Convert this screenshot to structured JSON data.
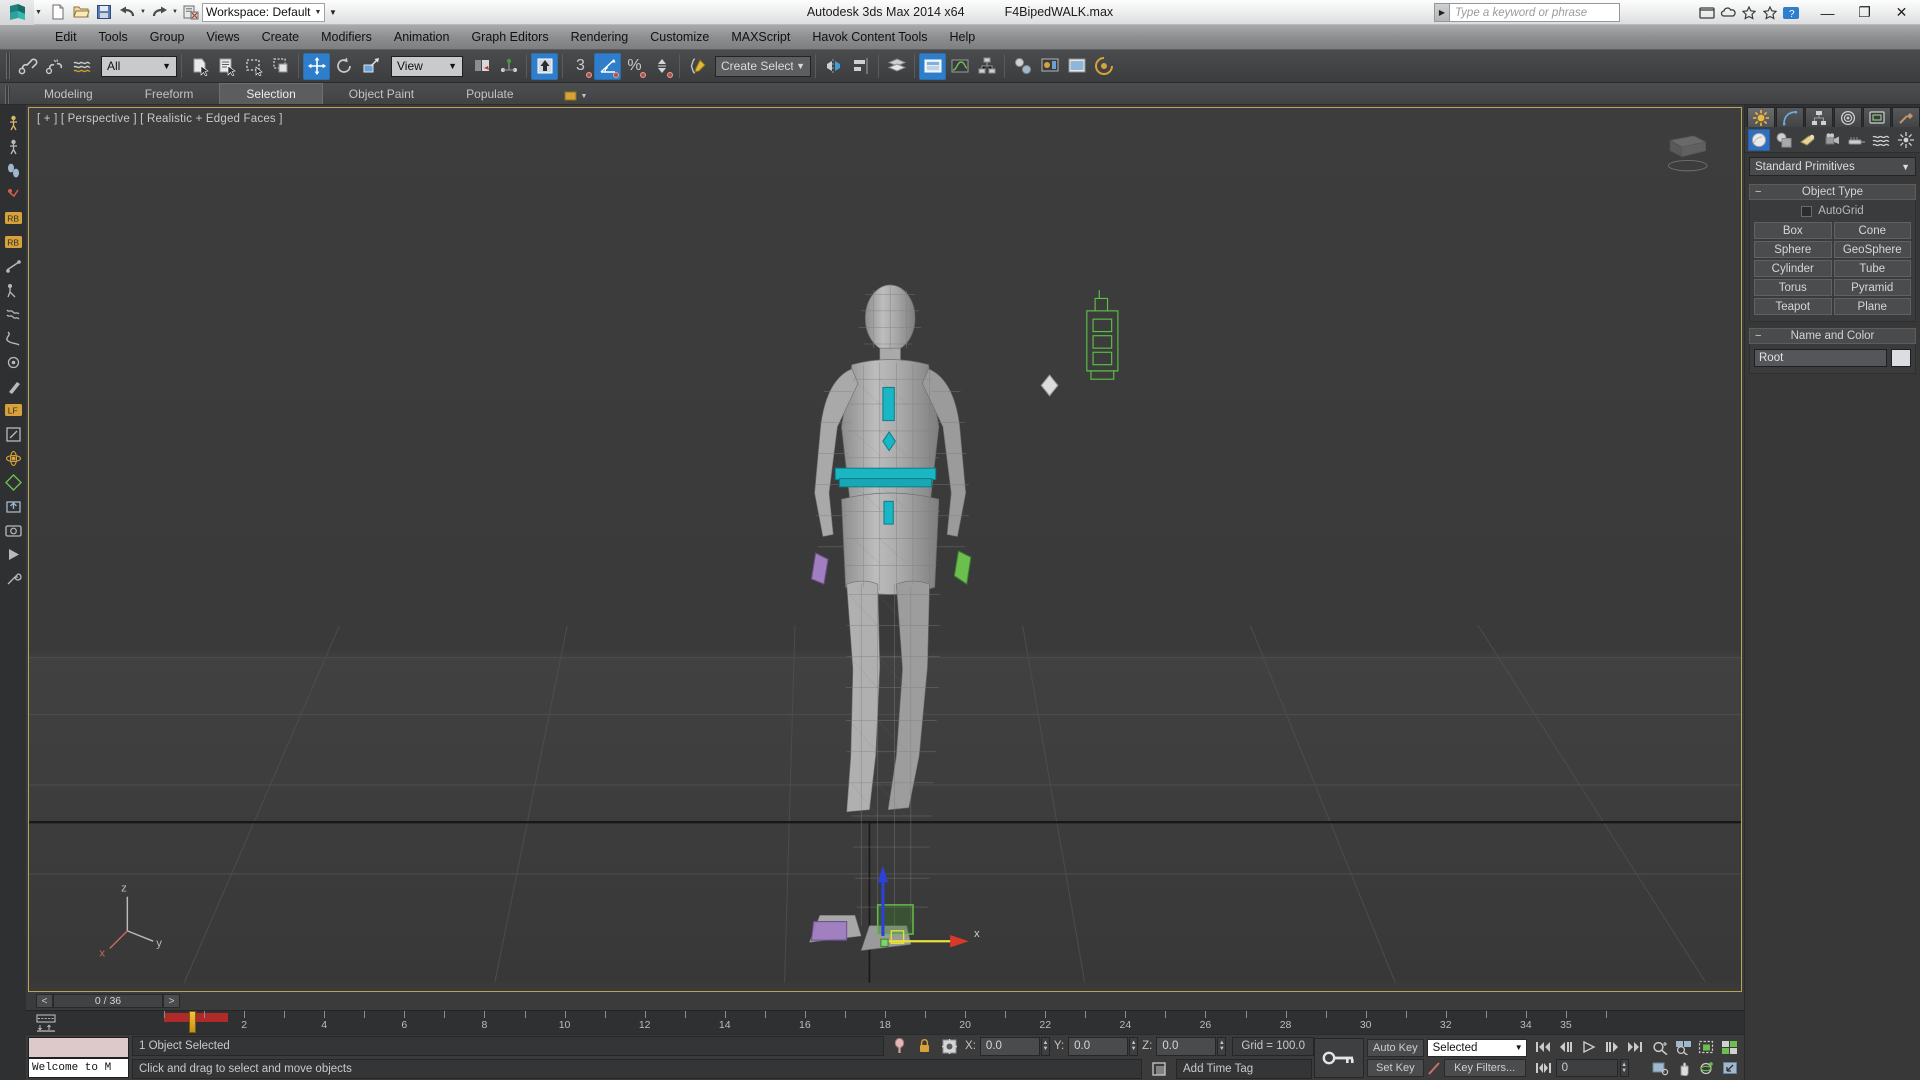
{
  "titlebar": {
    "app_title": "Autodesk 3ds Max  2014 x64",
    "file_name": "F4BipedWALK.max",
    "workspace_label": "Workspace: Default",
    "quick_access": [
      "new-icon",
      "open-icon",
      "save-icon",
      "undo-icon",
      "redo-icon",
      "project-folder-icon"
    ],
    "window_controls": {
      "minimize": "—",
      "restore": "❐",
      "close": "✕"
    }
  },
  "menu": {
    "items": [
      "Edit",
      "Tools",
      "Group",
      "Views",
      "Create",
      "Modifiers",
      "Animation",
      "Graph Editors",
      "Rendering",
      "Customize",
      "MAXScript",
      "Havok Content Tools",
      "Help"
    ]
  },
  "search": {
    "placeholder": "Type a keyword or phrase"
  },
  "toolbar": {
    "selection_filter": "All",
    "ref_coord_system": "View",
    "named_selection_set": "Create Selection Se",
    "angle_snap_value": "3",
    "buttons": [
      "select-link-icon",
      "unlink-icon",
      "bind-space-warp-icon",
      "select-object-icon",
      "select-by-name-icon",
      "rectangular-select-icon",
      "window-crossing-icon",
      "select-and-move-icon",
      "select-and-rotate-icon",
      "select-and-scale-icon",
      "use-pivot-center-icon",
      "select-and-manipulate-icon",
      "snap-toggle-icon",
      "angle-snap-icon",
      "percent-snap-icon",
      "spinner-snap-icon",
      "edit-named-selection-icon",
      "mirror-icon",
      "align-icon",
      "layer-manager-icon",
      "graphite-toggle-icon",
      "curve-editor-icon",
      "schematic-view-icon",
      "material-editor-icon",
      "render-setup-icon",
      "render-frame-icon",
      "render-production-icon"
    ]
  },
  "ribbon": {
    "tabs": [
      "Modeling",
      "Freeform",
      "Selection",
      "Object Paint",
      "Populate"
    ],
    "active_tab": "Selection"
  },
  "viewport": {
    "label": "[ + ] [ Perspective ] [ Realistic + Edged Faces ]",
    "grid_axis_x_label": "x",
    "axis_tripod": {
      "z": "z",
      "x": "x",
      "y": "y"
    }
  },
  "timeline": {
    "frame_display": "0 / 36",
    "prev_label": "<",
    "next_label": ">",
    "tick_labels": [
      "2",
      "4",
      "6",
      "8",
      "10",
      "12",
      "14",
      "16",
      "18",
      "20",
      "22",
      "24",
      "26",
      "28",
      "30",
      "32",
      "34",
      "35"
    ],
    "current_frame": 0,
    "total_frames": 36
  },
  "status": {
    "minilistener_text": "Welcome to M",
    "selection_status": "1 Object Selected",
    "prompt": "Click and drag to select and move objects",
    "coords": {
      "x_label": "X:",
      "x": "0.0",
      "y_label": "Y:",
      "y": "0.0",
      "z_label": "Z:",
      "z": "0.0"
    },
    "grid_text": "Grid = 100.0",
    "add_time_tag": "Add Time Tag"
  },
  "animation": {
    "auto_key": "Auto Key",
    "set_key": "Set Key",
    "key_filters": "Key Filters...",
    "key_mode_selected": "Selected",
    "current_frame_field": "0",
    "playback_icons": [
      "go-to-start-icon",
      "previous-frame-icon",
      "play-animation-icon",
      "next-frame-icon",
      "go-to-end-icon"
    ],
    "nav_icons": [
      "zoom-icon",
      "zoom-all-icon",
      "zoom-extents-icon",
      "zoom-extents-all-icon",
      "field-of-view-icon",
      "pan-view-icon",
      "orbit-icon",
      "maximize-viewport-icon"
    ]
  },
  "command_panel": {
    "tabs": [
      "create-tab-icon",
      "modify-tab-icon",
      "hierarchy-tab-icon",
      "motion-tab-icon",
      "display-tab-icon",
      "utilities-tab-icon"
    ],
    "active_tab_index": 0,
    "category_icons": [
      "geometry-icon",
      "shapes-icon",
      "lights-icon",
      "cameras-icon",
      "helpers-icon",
      "space-warps-icon",
      "systems-icon"
    ],
    "active_category_index": 0,
    "subcategory": "Standard Primitives",
    "object_type": {
      "title": "Object Type",
      "autogrid_label": "AutoGrid",
      "autogrid_checked": false,
      "buttons": [
        "Box",
        "Cone",
        "Sphere",
        "GeoSphere",
        "Cylinder",
        "Tube",
        "Torus",
        "Pyramid",
        "Teapot",
        "Plane"
      ]
    },
    "name_and_color": {
      "title": "Name and Color",
      "name": "Root",
      "color": "#dcdde0"
    }
  },
  "left_rail": {
    "icons": [
      "biped-create-icon",
      "biped-figure-icon",
      "biped-footstep-icon",
      "biped-motion-icon",
      "rb-solver-icon",
      "rb-body-icon",
      "constraint-icon",
      "ragdoll-icon",
      "cloth-icon",
      "rope-icon",
      "vertex-icon",
      "paint-icon",
      "lf-icon",
      "scale-icon",
      "physics-icon",
      "sim-icon",
      "export-icon",
      "capture-icon",
      "preview-icon",
      "tools-icon"
    ]
  },
  "theme": {
    "accent_blue": "#2f7ecb",
    "viewport_bg": "#3a3a3a",
    "panel_bg": "#383839",
    "highlight_gold": "#b9a45a",
    "rig_cyan": "#19b6c4",
    "rig_green": "#4fcf3f",
    "rig_red": "#d83a2a"
  }
}
